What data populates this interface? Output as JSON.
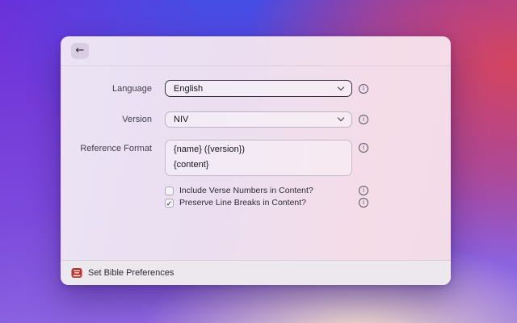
{
  "window": {
    "header": {
      "back_icon": "back-arrow-icon"
    },
    "form": {
      "language": {
        "label": "Language",
        "value": "English"
      },
      "version": {
        "label": "Version",
        "value": "NIV"
      },
      "reference_format": {
        "label": "Reference Format",
        "lines": [
          "{name} ({version})",
          "{content}"
        ]
      },
      "checkboxes": [
        {
          "label": "Include Verse Numbers in Content?",
          "checked": false,
          "mark": ""
        },
        {
          "label": "Preserve Line Breaks in Content?",
          "checked": true,
          "mark": "✓"
        }
      ]
    },
    "footer": {
      "title": "Set Bible Preferences"
    }
  },
  "icons": {
    "back": "←",
    "chevron_down": "chevron-down (CSS shape)",
    "info": "i",
    "check": "✓",
    "app": "bible-book-icon"
  },
  "colors": {
    "bg_purple": "#6d2ed8",
    "bg_blue": "#3f51e6",
    "bg_red": "#d4455f",
    "bg_glow": "#f8e6c6",
    "window_bg_left": "#ebe3f5",
    "window_bg_right": "#f5dde8",
    "focused_border": "#363040",
    "text_dark": "#17141c",
    "label_text": "#443f4c",
    "footer_bg": "#ebe8ee",
    "app_icon_red": "#b5342c"
  }
}
